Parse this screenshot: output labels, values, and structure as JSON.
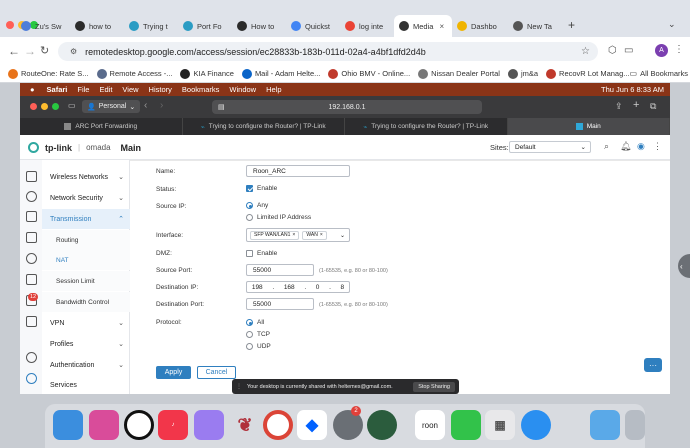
{
  "chrome": {
    "tabs": [
      {
        "label": "Zu's Sw",
        "color": "#4f7ed9"
      },
      {
        "label": "how to",
        "color": "#2b2b2b"
      },
      {
        "label": "Trying t",
        "color": "#2a9cc4"
      },
      {
        "label": "Port Fo",
        "color": "#2a9cc4"
      },
      {
        "label": "How to",
        "color": "#2b2b2b"
      },
      {
        "label": "Quickst",
        "color": "#4285f4"
      },
      {
        "label": "log inte",
        "color": "#ea4335"
      },
      {
        "label": "Media",
        "color": "#333"
      },
      {
        "label": "Dashbo",
        "color": "#f0b400"
      },
      {
        "label": "New Ta",
        "color": "#555"
      }
    ],
    "url": "remotedesktop.google.com/access/session/ec28833b-183b-011d-02a4-a4bf1dfd2d4b",
    "profile_initial": "A",
    "bookmarks": [
      {
        "label": "RouteOne: Rate S...",
        "color": "#e8731a"
      },
      {
        "label": "Remote Access -...",
        "color": "#5a6b8c"
      },
      {
        "label": "KIA Finance",
        "color": "#222"
      },
      {
        "label": "Mail - Adam Helte...",
        "color": "#0a64c8"
      },
      {
        "label": "Ohio BMV - Online...",
        "color": "#c0392b"
      },
      {
        "label": "Nissan Dealer Portal",
        "color": "#777"
      },
      {
        "label": "jm&a",
        "color": "#555"
      },
      {
        "label": "RecovR Lot Manag...",
        "color": "#c0392b"
      }
    ],
    "all_bookmarks": "All Bookmarks"
  },
  "mac": {
    "menus": [
      "Safari",
      "File",
      "Edit",
      "View",
      "History",
      "Bookmarks",
      "Window",
      "Help"
    ],
    "clock": "Thu Jun 6  8:33 AM"
  },
  "safari": {
    "profile": "Personal",
    "url": "192.168.0.1",
    "tabs": [
      {
        "label": "ARC Port Forwarding",
        "active": false
      },
      {
        "label": "Trying to configure the Router? | TP-Link",
        "active": false
      },
      {
        "label": "Trying to configure the Router? | TP-Link",
        "active": false
      },
      {
        "label": "Main",
        "active": true
      }
    ]
  },
  "omada": {
    "brand": "tp-link",
    "product": "omada",
    "page": "Main",
    "sites_label": "Sites:",
    "site_value": "Default"
  },
  "sidebar": {
    "badge": "12",
    "items": [
      {
        "label": "Wireless Networks",
        "chevron": "⌄"
      },
      {
        "label": "Network Security",
        "chevron": "⌄"
      },
      {
        "label": "Transmission",
        "chevron": "⌃"
      }
    ],
    "subitems": [
      "Routing",
      "NAT",
      "Session Limit",
      "Bandwidth Control"
    ],
    "items2": [
      {
        "label": "VPN",
        "chevron": "⌄"
      },
      {
        "label": "Profiles",
        "chevron": "⌄"
      },
      {
        "label": "Authentication",
        "chevron": "⌄"
      },
      {
        "label": "Services",
        "chevron": ""
      }
    ]
  },
  "form": {
    "name_label": "Name:",
    "name_value": "Roon_ARC",
    "status_label": "Status:",
    "status_option": "Enable",
    "source_ip_label": "Source IP:",
    "source_ip_any": "Any",
    "source_ip_limited": "Limited IP Address",
    "interface_label": "Interface:",
    "interface_tags": [
      "SFP WAN/LAN1",
      "WAN"
    ],
    "dmz_label": "DMZ:",
    "dmz_option": "Enable",
    "source_port_label": "Source Port:",
    "source_port_value": "55000",
    "source_port_hint": "(1-65535, e.g. 80 or 80-100)",
    "dest_ip_label": "Destination IP:",
    "dest_ip": [
      "198",
      "168",
      "0",
      "8"
    ],
    "dest_port_label": "Destination Port:",
    "dest_port_value": "55000",
    "dest_port_hint": "(1-65535, e.g. 80 or 80-100)",
    "protocol_label": "Protocol:",
    "protocols": [
      "All",
      "TCP",
      "UDP"
    ],
    "apply": "Apply",
    "cancel": "Cancel"
  },
  "share_bar": {
    "message": "Your desktop is currently shared with heltemes@gmail.com.",
    "button": "Stop Sharing"
  },
  "colors": {
    "accent": "#2f7fbf",
    "mac_menubar": "#8a3417",
    "dock_badge": "#e0403a"
  },
  "dock": {
    "badge": "2",
    "roon_label": "roon"
  }
}
